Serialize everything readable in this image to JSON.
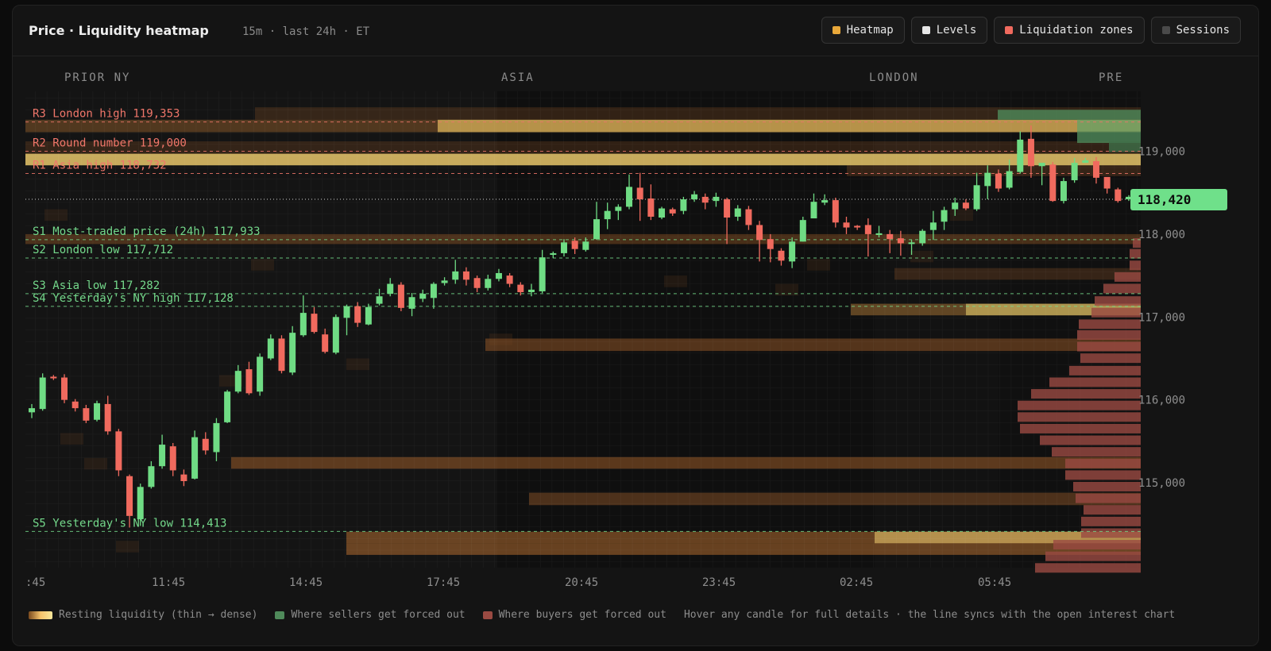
{
  "header": {
    "title": "Price · Liquidity heatmap",
    "subtitle": "15m · last 24h · ET",
    "toggles": [
      {
        "label": "Heatmap",
        "color": "#e9a83a"
      },
      {
        "label": "Levels",
        "color": "#e6e6e6"
      },
      {
        "label": "Liquidation zones",
        "color": "#f06a5e"
      },
      {
        "label": "Sessions",
        "color": "#4a4a4a"
      }
    ]
  },
  "sessions": [
    "PRIOR NY",
    "ASIA",
    "LONDON",
    "PRE"
  ],
  "colors": {
    "up": "#6fdc84",
    "down": "#f06a5e",
    "resistance": "#f0766a",
    "support": "#74d98b",
    "last_price_bg": "#6fe08a"
  },
  "chart_data": {
    "type": "candlestick",
    "y_ticks": [
      "119,000",
      "118,000",
      "117,000",
      "116,000",
      "115,000"
    ],
    "x_ticks": [
      ":45",
      "11:45",
      "14:45",
      "17:45",
      "20:45",
      "23:45",
      "02:45",
      "05:45"
    ],
    "last_price": "118,420",
    "last_price_value": 118420,
    "levels": [
      {
        "label": "R3 London high 119,353",
        "price": 119353,
        "kind": "resistance"
      },
      {
        "label": "R2 Round number 119,000",
        "price": 119000,
        "kind": "resistance"
      },
      {
        "label": "R1 Asia high 118,732",
        "price": 118732,
        "kind": "resistance"
      },
      {
        "label": "S1 Most-traded price (24h) 117,933",
        "price": 117933,
        "kind": "support"
      },
      {
        "label": "S2 London low 117,712",
        "price": 117712,
        "kind": "support"
      },
      {
        "label": "S3 Asia low 117,282",
        "price": 117282,
        "kind": "support"
      },
      {
        "label": "S4 Yesterday's NY high 117,128",
        "price": 117128,
        "kind": "support"
      },
      {
        "label": "S5 Yesterday's NY low 114,413",
        "price": 114413,
        "kind": "support"
      }
    ],
    "candles": [
      [
        115850,
        115900,
        115780,
        115950
      ],
      [
        115890,
        116270,
        115870,
        116320
      ],
      [
        116280,
        116260,
        116240,
        116300
      ],
      [
        116270,
        116000,
        115960,
        116310
      ],
      [
        115980,
        115900,
        115860,
        116010
      ],
      [
        115900,
        115750,
        115720,
        115940
      ],
      [
        115760,
        115960,
        115740,
        115990
      ],
      [
        115950,
        115620,
        115580,
        116050
      ],
      [
        115620,
        115150,
        115080,
        115650
      ],
      [
        115080,
        114600,
        114460,
        115100
      ],
      [
        114560,
        114950,
        114480,
        114990
      ],
      [
        114950,
        115200,
        114930,
        115260
      ],
      [
        115200,
        115460,
        115170,
        115580
      ],
      [
        115440,
        115150,
        115080,
        115480
      ],
      [
        115100,
        115020,
        114960,
        115160
      ],
      [
        115050,
        115550,
        115040,
        115630
      ],
      [
        115530,
        115390,
        115340,
        115610
      ],
      [
        115370,
        115720,
        115260,
        115780
      ],
      [
        115730,
        116100,
        115720,
        116120
      ],
      [
        116100,
        116350,
        116080,
        116420
      ],
      [
        116370,
        116080,
        116060,
        116460
      ],
      [
        116100,
        116520,
        116050,
        116560
      ],
      [
        116500,
        116740,
        116480,
        116790
      ],
      [
        116740,
        116350,
        116320,
        116780
      ],
      [
        116330,
        116810,
        116300,
        116890
      ],
      [
        116780,
        117050,
        116760,
        117260
      ],
      [
        117040,
        116820,
        116800,
        117120
      ],
      [
        116790,
        116580,
        116560,
        116860
      ],
      [
        116570,
        117000,
        116550,
        117030
      ],
      [
        116990,
        117130,
        116780,
        117150
      ],
      [
        117130,
        116930,
        116880,
        117180
      ],
      [
        116910,
        117120,
        116900,
        117160
      ],
      [
        117160,
        117250,
        117140,
        117340
      ],
      [
        117280,
        117400,
        117250,
        117470
      ],
      [
        117390,
        117110,
        117070,
        117420
      ],
      [
        117100,
        117240,
        117010,
        117290
      ],
      [
        117220,
        117280,
        117180,
        117330
      ],
      [
        117230,
        117400,
        117100,
        117420
      ],
      [
        117410,
        117440,
        117380,
        117480
      ],
      [
        117450,
        117550,
        117400,
        117690
      ],
      [
        117550,
        117450,
        117380,
        117600
      ],
      [
        117470,
        117350,
        117300,
        117500
      ],
      [
        117350,
        117460,
        117320,
        117510
      ],
      [
        117460,
        117530,
        117430,
        117580
      ],
      [
        117500,
        117400,
        117360,
        117530
      ],
      [
        117390,
        117300,
        117260,
        117420
      ],
      [
        117300,
        117330,
        117250,
        117400
      ],
      [
        117310,
        117720,
        117290,
        117810
      ],
      [
        117750,
        117770,
        117710,
        117790
      ],
      [
        117770,
        117900,
        117730,
        117940
      ],
      [
        117920,
        117820,
        117760,
        117960
      ],
      [
        117810,
        117910,
        117790,
        117960
      ],
      [
        117940,
        118180,
        117930,
        118390
      ],
      [
        118180,
        118280,
        118060,
        118380
      ],
      [
        118280,
        118330,
        118170,
        118360
      ],
      [
        118330,
        118570,
        118300,
        118720
      ],
      [
        118560,
        118420,
        118160,
        118740
      ],
      [
        118430,
        118210,
        118170,
        118600
      ],
      [
        118200,
        118310,
        118180,
        118330
      ],
      [
        118300,
        118250,
        118220,
        118320
      ],
      [
        118280,
        118420,
        118240,
        118450
      ],
      [
        118420,
        118480,
        118390,
        118520
      ],
      [
        118450,
        118380,
        118300,
        118490
      ],
      [
        118400,
        118450,
        118330,
        118500
      ],
      [
        118420,
        118200,
        117880,
        118440
      ],
      [
        118210,
        118310,
        118160,
        118350
      ],
      [
        118300,
        118110,
        118050,
        118340
      ],
      [
        118110,
        117930,
        117670,
        118160
      ],
      [
        117940,
        117820,
        117660,
        118000
      ],
      [
        117800,
        117680,
        117620,
        117830
      ],
      [
        117670,
        117910,
        117590,
        117960
      ],
      [
        117910,
        118170,
        117910,
        118210
      ],
      [
        118190,
        118390,
        118200,
        118490
      ],
      [
        118380,
        118410,
        118350,
        118480
      ],
      [
        118410,
        118140,
        118080,
        118440
      ],
      [
        118140,
        118080,
        118000,
        118210
      ],
      [
        118100,
        118080,
        118050,
        118110
      ],
      [
        118110,
        118000,
        117730,
        118190
      ],
      [
        117990,
        118010,
        117960,
        118100
      ],
      [
        118000,
        117940,
        117770,
        118050
      ],
      [
        117950,
        117890,
        117740,
        118040
      ],
      [
        117890,
        117900,
        117750,
        117930
      ],
      [
        117890,
        118040,
        117860,
        118060
      ],
      [
        118050,
        118140,
        117930,
        118280
      ],
      [
        118150,
        118290,
        118050,
        118330
      ],
      [
        118300,
        118380,
        118220,
        118440
      ],
      [
        118380,
        118310,
        118290,
        118420
      ],
      [
        118300,
        118590,
        118280,
        118740
      ],
      [
        118580,
        118740,
        118420,
        118830
      ],
      [
        118730,
        118550,
        118510,
        118780
      ],
      [
        118560,
        118760,
        118540,
        118900
      ],
      [
        118750,
        119140,
        118730,
        119240
      ],
      [
        119150,
        118820,
        118680,
        119310
      ],
      [
        118820,
        118860,
        118590,
        118860
      ],
      [
        118840,
        118400,
        118390,
        118870
      ],
      [
        118400,
        118640,
        118370,
        118680
      ],
      [
        118650,
        118860,
        118620,
        118920
      ],
      [
        118860,
        118890,
        118860,
        118920
      ],
      [
        118880,
        118680,
        118610,
        118930
      ],
      [
        118690,
        118550,
        118490,
        118670
      ],
      [
        118540,
        118400,
        118380,
        118560
      ],
      [
        118420,
        118450,
        118400,
        118470
      ]
    ]
  },
  "footer": {
    "items": [
      {
        "label": "Resting liquidity (thin → dense)"
      },
      {
        "label": "Where sellers get forced out"
      },
      {
        "label": "Where buyers get forced out"
      }
    ],
    "note": "Hover any candle for full details · the line syncs with the open interest chart"
  }
}
